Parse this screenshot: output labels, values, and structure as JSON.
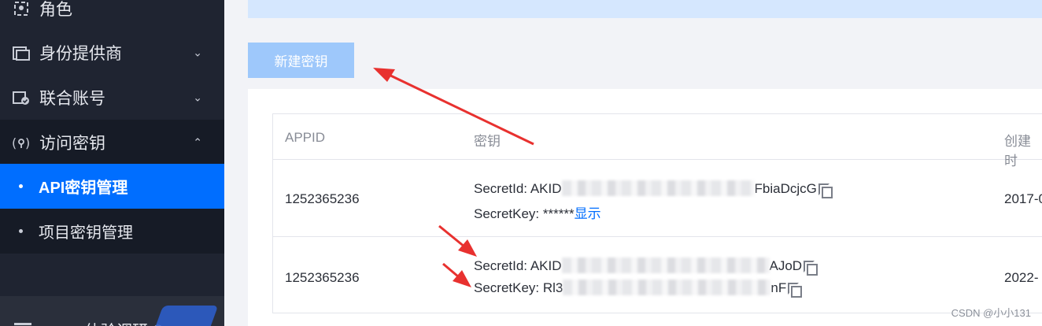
{
  "sidebar": {
    "items": [
      {
        "label": "角色",
        "icon": "role-icon"
      },
      {
        "label": "身份提供商",
        "icon": "identity-provider-icon",
        "chevron": "⌄"
      },
      {
        "label": "联合账号",
        "icon": "federated-account-icon",
        "chevron": "⌄"
      },
      {
        "label": "访问密钥",
        "icon": "access-key-icon",
        "chevron": "⌃"
      }
    ],
    "sub_items": [
      {
        "label": "API密钥管理",
        "selected": true
      },
      {
        "label": "项目密钥管理",
        "selected": false
      }
    ],
    "bottom_text": "体验调研 ©"
  },
  "toolbar": {
    "new_key_label": "新建密钥"
  },
  "table": {
    "columns": [
      "APPID",
      "密钥",
      "创建时"
    ],
    "rows": [
      {
        "appid": "1252365236",
        "secret_id_label": "SecretId: ",
        "secret_id_prefix": "AKID",
        "secret_id_suffix": "FbiaDcjcG",
        "secret_key_label": "SecretKey: ",
        "secret_key_value": "******",
        "secret_key_action": "显示",
        "created": "2017-0"
      },
      {
        "appid": "1252365236",
        "secret_id_label": "SecretId: ",
        "secret_id_prefix": "AKID",
        "secret_id_suffix": "AJoD",
        "secret_key_label": "SecretKey: ",
        "secret_key_prefix": "Rl3",
        "secret_key_suffix": "nF",
        "created": "2022-"
      }
    ]
  },
  "watermark": "CSDN @小小131",
  "colors": {
    "accent": "#006eff",
    "annotation": "#e8312f",
    "sidebar_bg": "#1f2431"
  }
}
